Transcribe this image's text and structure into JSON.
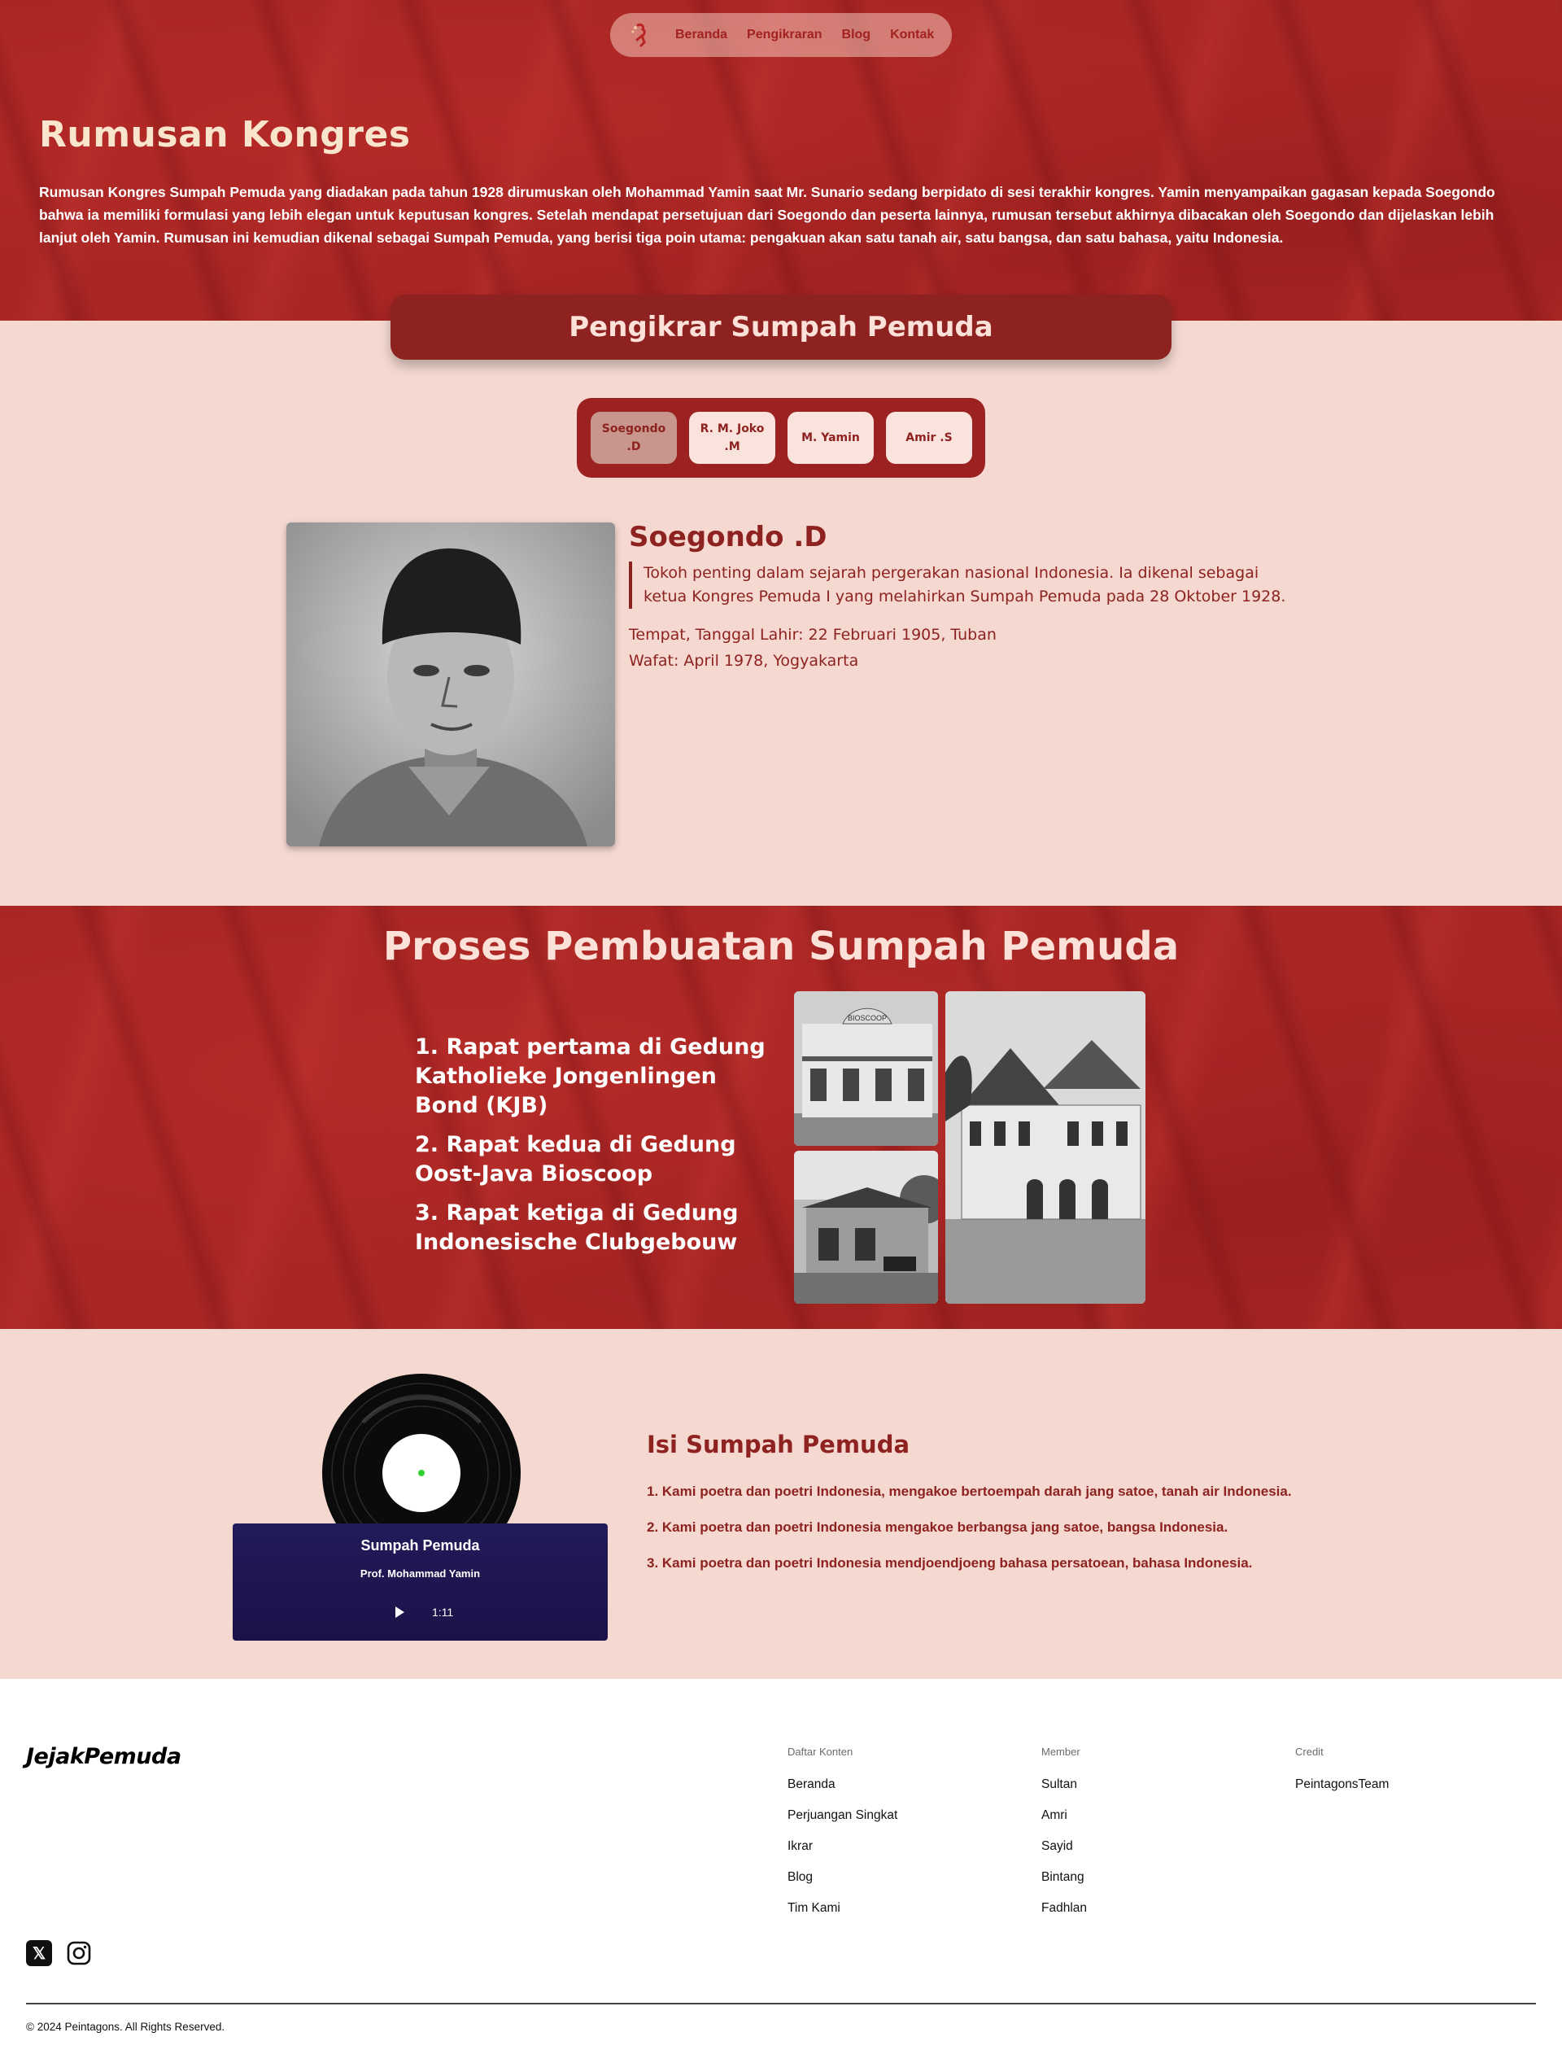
{
  "nav": {
    "links": [
      "Beranda",
      "Pengikraran",
      "Blog",
      "Kontak"
    ]
  },
  "hero": {
    "title": "Rumusan Kongres",
    "text": "Rumusan Kongres Sumpah Pemuda yang diadakan pada tahun 1928 dirumuskan oleh Mohammad Yamin saat Mr. Sunario sedang berpidato di sesi terakhir kongres. Yamin menyampaikan gagasan kepada Soegondo bahwa ia memiliki formulasi yang lebih elegan untuk keputusan kongres. Setelah mendapat persetujuan dari Soegondo dan peserta lainnya, rumusan tersebut akhirnya dibacakan oleh Soegondo dan dijelaskan lebih lanjut oleh Yamin. Rumusan ini kemudian dikenal sebagai Sumpah Pemuda, yang berisi tiga poin utama: pengakuan akan satu tanah air, satu bangsa, dan satu bahasa, yaitu Indonesia."
  },
  "pengikrar": {
    "title": "Pengikrar Sumpah Pemuda",
    "tabs": [
      {
        "line1": "Soegondo",
        "line2": ".D"
      },
      {
        "line1": "R. M. Joko",
        "line2": ".M"
      },
      {
        "line1": "M. Yamin",
        "line2": ""
      },
      {
        "line1": "Amir .S",
        "line2": ""
      }
    ],
    "selected": {
      "name": "Soegondo .D",
      "description": "Tokoh penting dalam sejarah pergerakan nasional Indonesia. Ia dikenal sebagai ketua Kongres Pemuda I yang melahirkan Sumpah Pemuda pada 28 Oktober 1928.",
      "birth": "Tempat, Tanggal Lahir: 22 Februari 1905, Tuban",
      "death": "Wafat: April 1978, Yogyakarta"
    }
  },
  "proses": {
    "title": "Proses Pembuatan Sumpah Pemuda",
    "items": [
      "1. Rapat pertama di Gedung Katholieke Jongenlingen Bond (KJB)",
      "2. Rapat kedua di Gedung Oost-Java Bioscoop",
      "3. Rapat ketiga di Gedung Indonesische Clubgebouw"
    ],
    "photo_sign": "BIOSCOOP"
  },
  "isi": {
    "title": "Isi Sumpah Pemuda",
    "items": [
      "1. Kami poetra dan poetri Indonesia, mengakoe bertoempah darah jang satoe, tanah air Indonesia.",
      "2. Kami poetra dan poetri Indonesia mengakoe berbangsa jang satoe, bangsa Indonesia.",
      "3. Kami poetra dan poetri Indonesia mendjoendjoeng bahasa persatoean, bahasa Indonesia."
    ],
    "player": {
      "title": "Sumpah Pemuda",
      "artist": "Prof. Mohammad Yamin",
      "duration": "1:11"
    }
  },
  "footer": {
    "brand": "JejakPemuda",
    "columns": [
      {
        "heading": "Daftar Konten",
        "links": [
          "Beranda",
          "Perjuangan Singkat",
          "Ikrar",
          "Blog",
          "Tim Kami"
        ]
      },
      {
        "heading": "Member",
        "links": [
          "Sultan",
          "Amri",
          "Sayid",
          "Bintang",
          "Fadhlan"
        ]
      },
      {
        "heading": "Credit",
        "links": [
          "PeintagonsTeam"
        ]
      }
    ],
    "social_x": "𝕏",
    "copyright": "© 2024 Peintagons. All Rights Reserved."
  },
  "colors": {
    "primary": "#8e2220",
    "hero_bg": "#a82624",
    "page_bg": "#f5d9d1",
    "player_bg": "#1f1752"
  },
  "icons": [
    "logo-icon",
    "play-icon",
    "x-icon",
    "instagram-icon"
  ]
}
